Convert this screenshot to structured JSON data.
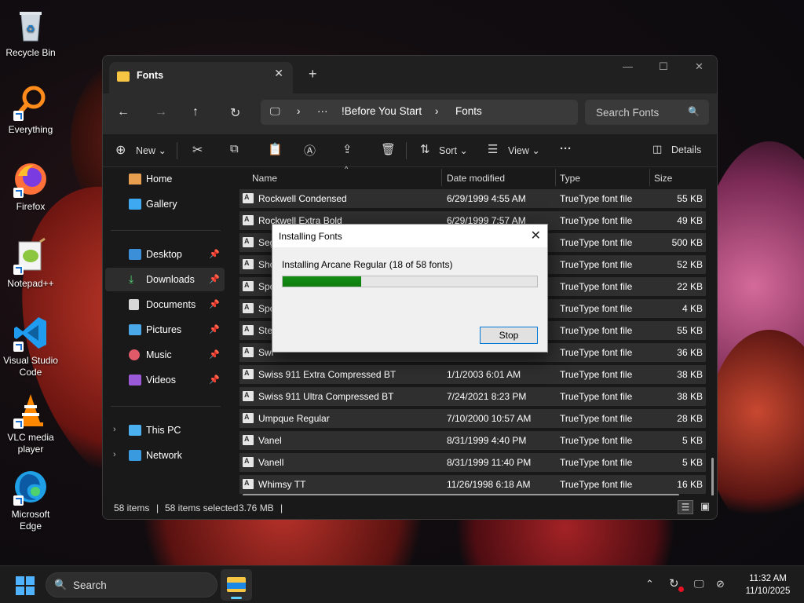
{
  "desktop": {
    "icons": [
      {
        "label": "Recycle Bin"
      },
      {
        "label": "Everything"
      },
      {
        "label": "Firefox"
      },
      {
        "label": "Notepad++"
      },
      {
        "label": "Visual Studio Code"
      },
      {
        "label": "VLC media player"
      },
      {
        "label": "Microsoft Edge"
      }
    ]
  },
  "explorer": {
    "tab_title": "Fonts",
    "breadcrumb": [
      "!Before You Start",
      "Fonts"
    ],
    "breadcrumb_more": "···",
    "search_placeholder": "Search Fonts",
    "toolbar": {
      "new_label": "New",
      "sort_label": "Sort",
      "view_label": "View",
      "more_label": "···",
      "details_label": "Details"
    },
    "sidebar": {
      "home": "Home",
      "gallery": "Gallery",
      "desktop": "Desktop",
      "downloads": "Downloads",
      "documents": "Documents",
      "pictures": "Pictures",
      "music": "Music",
      "videos": "Videos",
      "this_pc": "This PC",
      "network": "Network"
    },
    "columns": {
      "name": "Name",
      "date": "Date modified",
      "type": "Type",
      "size": "Size"
    },
    "files": [
      {
        "name": "Rockwell Condensed",
        "date": "6/29/1999 4:55 AM",
        "type": "TrueType font file",
        "size": "55 KB"
      },
      {
        "name": "Rockwell Extra Bold",
        "date": "6/29/1999 7:57 AM",
        "type": "TrueType font file",
        "size": "49 KB"
      },
      {
        "name": "Seg",
        "date": "",
        "type": "TrueType font file",
        "size": "500 KB"
      },
      {
        "name": "Sho",
        "date": "",
        "type": "TrueType font file",
        "size": "52 KB"
      },
      {
        "name": "Spo",
        "date": "",
        "type": "TrueType font file",
        "size": "22 KB"
      },
      {
        "name": "Spo",
        "date": "",
        "type": "TrueType font file",
        "size": "4 KB"
      },
      {
        "name": "Ster",
        "date": "",
        "type": "TrueType font file",
        "size": "55 KB"
      },
      {
        "name": "Swi",
        "date": "",
        "type": "TrueType font file",
        "size": "36 KB"
      },
      {
        "name": "Swiss 911 Extra Compressed BT",
        "date": "1/1/2003 6:01 AM",
        "type": "TrueType font file",
        "size": "38 KB"
      },
      {
        "name": "Swiss 911 Ultra Compressed BT",
        "date": "7/24/2021 8:23 PM",
        "type": "TrueType font file",
        "size": "38 KB"
      },
      {
        "name": "Umpque Regular",
        "date": "7/10/2000 10:57 AM",
        "type": "TrueType font file",
        "size": "28 KB"
      },
      {
        "name": "Vanel",
        "date": "8/31/1999 4:40 PM",
        "type": "TrueType font file",
        "size": "5 KB"
      },
      {
        "name": "Vanell",
        "date": "8/31/1999 11:40 PM",
        "type": "TrueType font file",
        "size": "5 KB"
      },
      {
        "name": "Whimsy TT",
        "date": "11/26/1998 6:18 AM",
        "type": "TrueType font file",
        "size": "16 KB"
      }
    ],
    "status": {
      "items": "58 items",
      "selected": "58 items selected",
      "size": "3.76 MB",
      "bar": "|"
    }
  },
  "dialog": {
    "title": "Installing Fonts",
    "message": "Installing Arcane Regular (18 of 58 fonts)",
    "progress_fraction": 0.31,
    "stop_label": "Stop"
  },
  "taskbar": {
    "search_placeholder": "Search",
    "time": "11:32 AM",
    "date": "11/10/2025"
  },
  "colors": {
    "accent": "#0078d7",
    "progress": "#148f14",
    "folder": "#f6c544"
  }
}
